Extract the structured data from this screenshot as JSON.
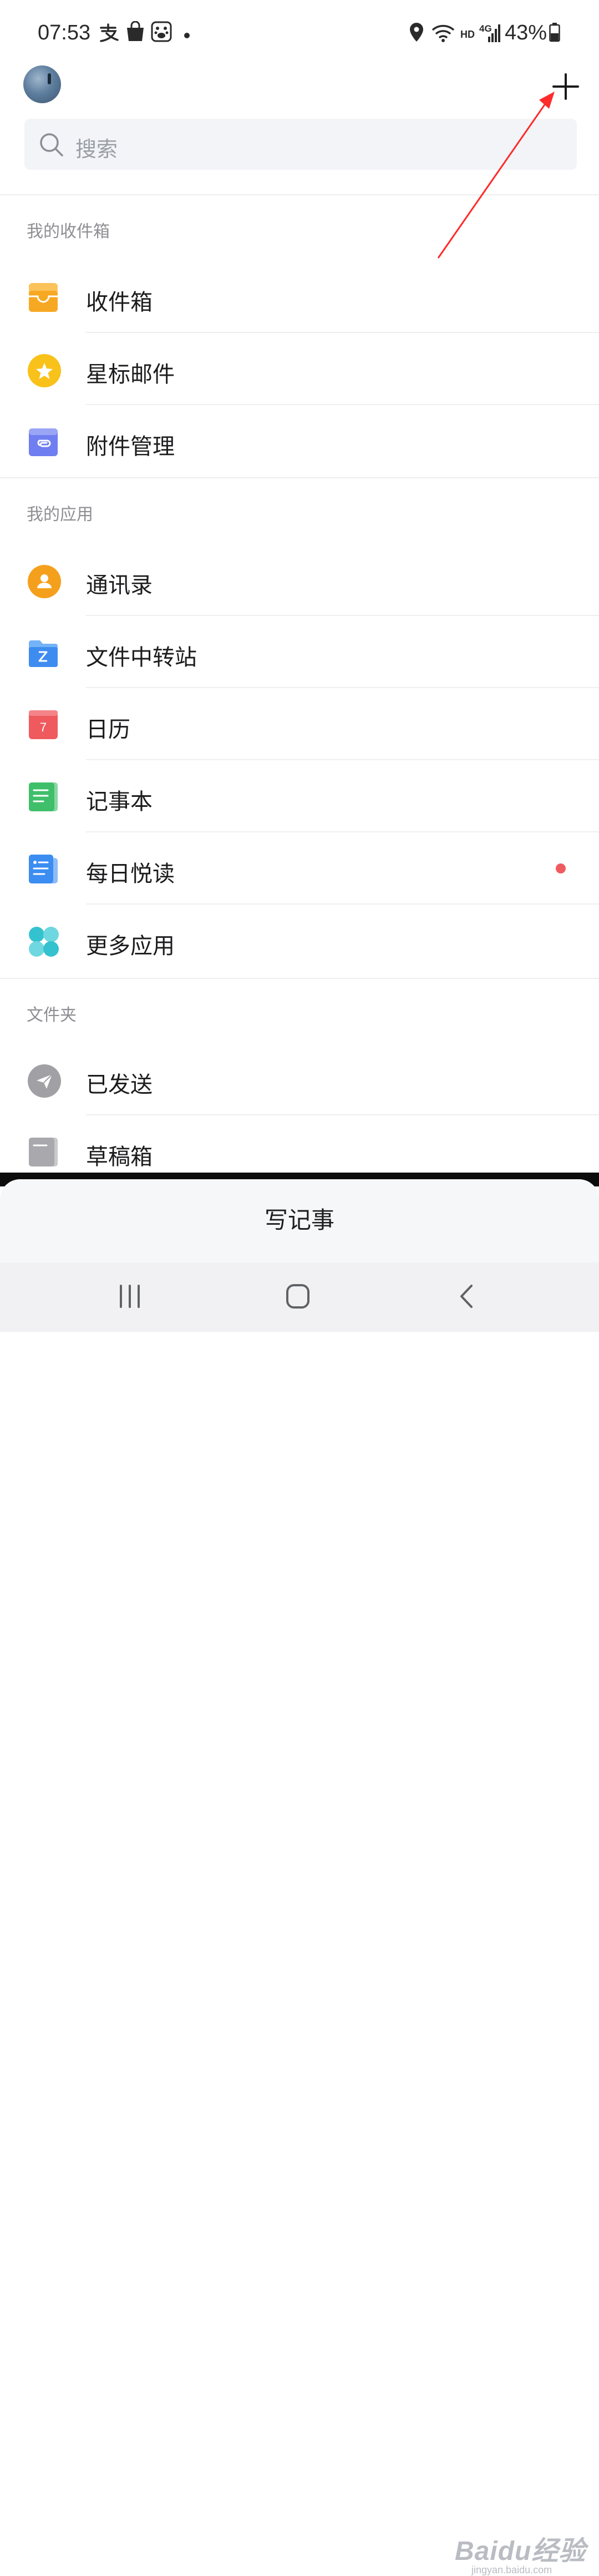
{
  "status_bar": {
    "time": "07:53",
    "network_badge_hd": "HD",
    "network_badge_4g": "4G",
    "battery_percent": "43%",
    "left_icons": [
      "alipay-icon",
      "shopping-bag-icon",
      "baidu-paw-icon",
      "dot-icon"
    ],
    "right_icons": [
      "location-icon",
      "wifi-icon",
      "signal-icon",
      "battery-icon"
    ]
  },
  "header": {
    "account_name": "",
    "add_icon": "plus-icon"
  },
  "search": {
    "placeholder": "搜索"
  },
  "sections": [
    {
      "title": "我的收件箱",
      "items": [
        {
          "label": "收件箱",
          "icon": "inbox-tray-icon"
        },
        {
          "label": "星标邮件",
          "icon": "star-icon"
        },
        {
          "label": "附件管理",
          "icon": "attachment-icon"
        }
      ]
    },
    {
      "title": "我的应用",
      "items": [
        {
          "label": "通讯录",
          "icon": "contacts-icon"
        },
        {
          "label": "文件中转站",
          "icon": "folder-z-icon"
        },
        {
          "label": "日历",
          "icon": "calendar-icon",
          "icon_text": "7"
        },
        {
          "label": "记事本",
          "icon": "notepad-icon"
        },
        {
          "label": "每日悦读",
          "icon": "daily-reading-icon",
          "has_badge": true
        },
        {
          "label": "更多应用",
          "icon": "more-apps-icon"
        }
      ]
    },
    {
      "title": "文件夹",
      "items": [
        {
          "label": "已发送",
          "icon": "sent-icon"
        },
        {
          "label": "草稿箱",
          "icon": "drafts-icon"
        }
      ]
    }
  ],
  "bottom_sheet": {
    "action_label": "写记事"
  },
  "nav_bar": {
    "buttons": [
      "recents-icon",
      "home-icon",
      "back-icon"
    ]
  },
  "watermark": {
    "main": "Baidu经验",
    "sub": "jingyan.baidu.com"
  },
  "colors": {
    "inbox": "#f7a823",
    "star": "#f8c21b",
    "attachment": "#6f7ef0",
    "contacts": "#f4a01c",
    "folder": "#3f8cf0",
    "calendar": "#ef5a5f",
    "notepad": "#3fbf6a",
    "daily": "#3b8df2",
    "more": "#35c2cf",
    "sent": "#a0a0a5",
    "drafts": "#a8a8ad",
    "badge": "#ef5a5f",
    "annotation_arrow": "#ff2a2a"
  }
}
